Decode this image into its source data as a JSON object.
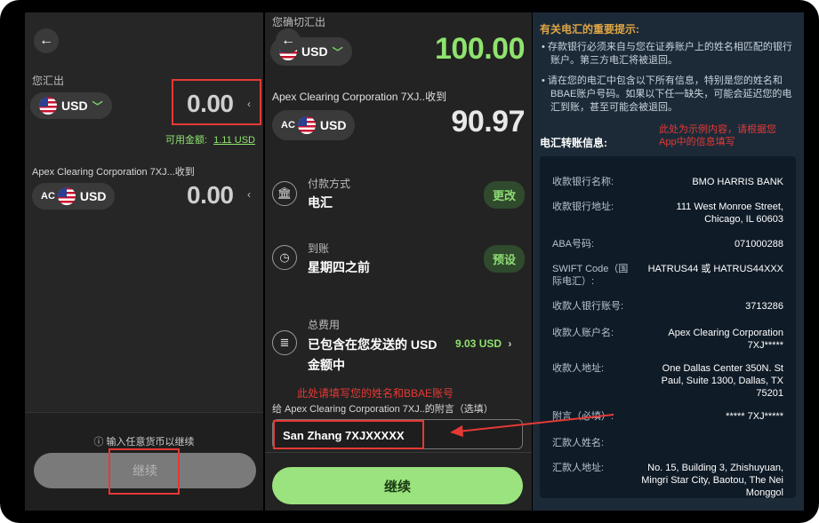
{
  "panel_send": {
    "send_label": "您汇出",
    "send_currency": "USD",
    "send_amount": "0.00",
    "available_label": "可用金额:",
    "available_value": "1.11 USD",
    "receive_label": "Apex Clearing Corporation 7XJ...收到",
    "receive_prefix": "AC",
    "receive_currency": "USD",
    "receive_amount": "0.00",
    "hint": "输入任意货币以继续",
    "continue_label": "继续"
  },
  "panel_confirm": {
    "send_label": "您确切汇出",
    "send_currency": "USD",
    "send_amount": "100.00",
    "receive_label": "Apex Clearing Corporation 7XJ..收到",
    "receive_prefix": "AC",
    "receive_currency": "USD",
    "receive_amount": "90.97",
    "payment_method_label": "付款方式",
    "payment_method_value": "电汇",
    "change_button": "更改",
    "arrival_label": "到账",
    "arrival_value": "星期四之前",
    "preset_button": "预设",
    "fee_label": "总费用",
    "fee_value_line1": "已包含在您发送的 USD",
    "fee_value_line2": "金额中",
    "fee_amount": "9.03 USD",
    "annotation": "此处请填写您的姓名和BBAE账号",
    "memo_label": "给 Apex Clearing Corporation 7XJ..的附言（选填）",
    "memo_value": "San Zhang 7XJXXXXX",
    "continue_label": "继续"
  },
  "panel_info": {
    "notice_title": "有关电汇的重要提示:",
    "notice_1": "存款银行必须来自与您在证券账户上的姓名相匹配的银行账户。第三方电汇将被退回。",
    "notice_2": "请在您的电汇中包含以下所有信息，特别是您的姓名和BBAE账户号码。如果以下任一缺失，可能会延迟您的电汇到账，甚至可能会被退回。",
    "info_title": "电汇转账信息:",
    "annotation": "此处为示例内容，请根据您App中的信息填写",
    "rows": [
      {
        "k": "收款银行名称:",
        "v": "BMO HARRIS BANK"
      },
      {
        "k": "收款银行地址:",
        "v": "111 West Monroe Street, Chicago, IL 60603"
      },
      {
        "k": "ABA号码:",
        "v": "071000288"
      },
      {
        "k": "SWIFT Code（国际电汇）:",
        "v": "HATRUS44 或 HATRUS44XXX"
      },
      {
        "k": "收款人银行账号:",
        "v": "3713286"
      },
      {
        "k": "收款人账户名:",
        "v": "Apex Clearing Corporation 7XJ*****"
      },
      {
        "k": "收款人地址:",
        "v": "One Dallas Center 350N. St Paul, Suite 1300, Dallas, TX 75201"
      },
      {
        "k": "附言（必填）:",
        "v": "*****  7XJ*****"
      },
      {
        "k": "汇款人姓名:",
        "v": ""
      },
      {
        "k": "汇款人地址:",
        "v": "No. 15, Building 3, Zhishuyuan, Mingri Star City, Baotou, The Nei Monggol"
      }
    ]
  },
  "colors": {
    "accent_green": "#8fe36e",
    "annotation_red": "#e53935",
    "info_bg": "#1c2a38"
  }
}
